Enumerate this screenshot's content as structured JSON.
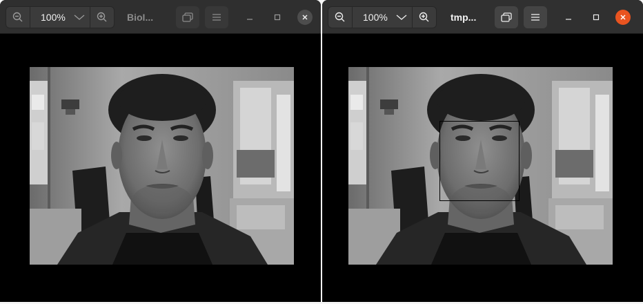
{
  "windows": [
    {
      "title": "BioI...",
      "zoom": "100%",
      "active": false,
      "face_box": false,
      "icons": {
        "zoom_out": "zoom-out-icon",
        "zoom_menu": "chevron-down-icon",
        "zoom_in": "zoom-in-icon",
        "fit": "fit-window-icon",
        "menu": "hamburger-menu-icon",
        "minimize": "minimize-icon",
        "maximize": "maximize-icon",
        "close": "close-icon"
      }
    },
    {
      "title": "tmp...",
      "zoom": "100%",
      "active": true,
      "face_box": true,
      "icons": {
        "zoom_out": "zoom-out-icon",
        "zoom_menu": "chevron-down-icon",
        "zoom_in": "zoom-in-icon",
        "fit": "fit-window-icon",
        "menu": "hamburger-menu-icon",
        "minimize": "minimize-icon",
        "maximize": "maximize-icon",
        "close": "close-icon"
      }
    }
  ],
  "colors": {
    "headerbar": "#2f2f2f",
    "viewer_background": "#000000",
    "close_active": "#e95420",
    "close_inactive": "#4d4d4d",
    "face_box_outline": "#000000"
  }
}
